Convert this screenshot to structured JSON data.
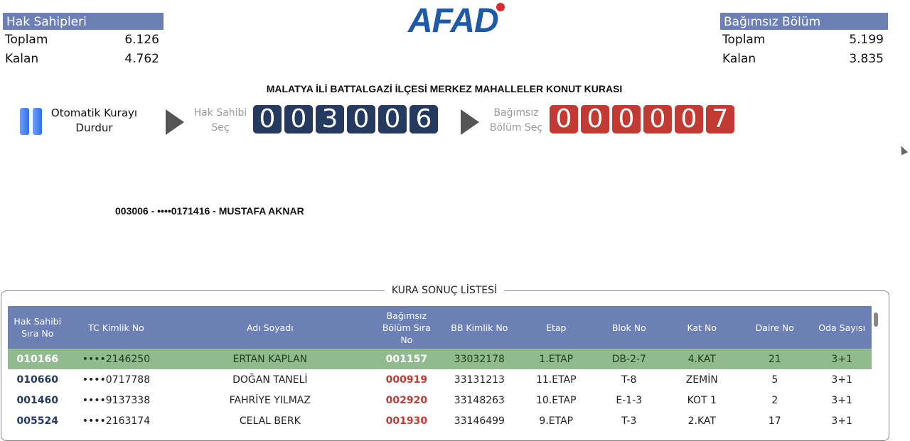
{
  "hak_sahipleri": {
    "title": "Hak Sahipleri",
    "toplam_label": "Toplam",
    "toplam": "6.126",
    "kalan_label": "Kalan",
    "kalan": "4.762"
  },
  "bagimsiz_bolum": {
    "title": "Bağımsız Bölüm",
    "toplam_label": "Toplam",
    "toplam": "5.199",
    "kalan_label": "Kalan",
    "kalan": "3.835"
  },
  "logo": {
    "text": "AFAD"
  },
  "page_title": "MALATYA İLİ BATTALGAZİ İLÇESİ MERKEZ MAHALLELER KONUT KURASI",
  "controls": {
    "auto_label_line1": "Otomatik Kurayı",
    "auto_label_line2": "Durdur",
    "hak_sahibi_line1": "Hak Sahibi",
    "hak_sahibi_line2": "Seç",
    "hak_digits": [
      "0",
      "0",
      "3",
      "0",
      "0",
      "6"
    ],
    "bagimsiz_line1": "Bağımsız",
    "bagimsiz_line2": "Bölüm Seç",
    "bolum_digits": [
      "0",
      "0",
      "0",
      "0",
      "0",
      "7"
    ]
  },
  "selected_line": "003006 - ••••0171416 - MUSTAFA AKNAR",
  "results": {
    "legend": "KURA SONUÇ LİSTESİ",
    "headers": {
      "hak_sira": "Hak Sahibi Sıra No",
      "tc": "TC Kimlik No",
      "ad": "Adı Soyadı",
      "bolum_sira": "Bağımsız Bölüm Sıra No",
      "bb": "BB Kimlik No",
      "etap": "Etap",
      "blok": "Blok No",
      "kat": "Kat No",
      "daire": "Daire No",
      "oda": "Oda Sayısı"
    },
    "rows": [
      {
        "hak_sira": "010166",
        "tc": "••••2146250",
        "ad": "ERTAN KAPLAN",
        "bolum_sira": "001157",
        "bb": "33032178",
        "etap": "1.ETAP",
        "blok": "DB-2-7",
        "kat": "4.KAT",
        "daire": "21",
        "oda": "3+1"
      },
      {
        "hak_sira": "010660",
        "tc": "••••0717788",
        "ad": "DOĞAN TANELİ",
        "bolum_sira": "000919",
        "bb": "33131213",
        "etap": "11.ETAP",
        "blok": "T-8",
        "kat": "ZEMİN",
        "daire": "5",
        "oda": "3+1"
      },
      {
        "hak_sira": "001460",
        "tc": "••••9137338",
        "ad": "FAHRİYE YILMAZ",
        "bolum_sira": "002920",
        "bb": "33148263",
        "etap": "10.ETAP",
        "blok": "E-1-3",
        "kat": "KOT 1",
        "daire": "2",
        "oda": "3+1"
      },
      {
        "hak_sira": "005524",
        "tc": "••••2163174",
        "ad": "CELAL BERK",
        "bolum_sira": "001930",
        "bb": "33146499",
        "etap": "9.ETAP",
        "blok": "T-3",
        "kat": "2.KAT",
        "daire": "17",
        "oda": "3+1"
      }
    ]
  },
  "colors": {
    "accent": "#6c80b6",
    "digit_blue": "#243a5e",
    "digit_red": "#c33a33",
    "highlight_row": "#8fbb8e"
  }
}
